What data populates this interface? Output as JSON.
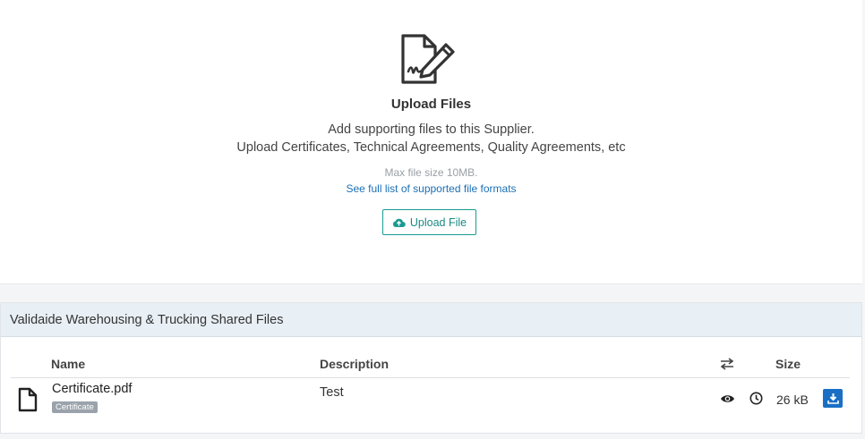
{
  "upload": {
    "icon": "signed-document-icon",
    "title": "Upload Files",
    "description_line1": "Add supporting files to this Supplier.",
    "description_line2": "Upload Certificates, Technical Agreements, Quality Agreements, etc",
    "max_size": "Max file size 10MB.",
    "formats_link": "See full list of supported file formats",
    "button_label": "Upload File",
    "button_icon": "cloud-upload-icon",
    "accent_color": "#1a9a92"
  },
  "files": {
    "header": "Validaide Warehousing & Trucking Shared Files",
    "columns": {
      "name": "Name",
      "description": "Description",
      "sync_icon": "swap-arrows-icon",
      "size": "Size"
    },
    "rows": [
      {
        "icon": "file-icon",
        "name": "Certificate.pdf",
        "badge": "Certificate",
        "description": "Test",
        "view_icon": "eye-icon",
        "history_icon": "clock-icon",
        "size": "26 kB",
        "download_icon": "download-icon"
      }
    ]
  }
}
